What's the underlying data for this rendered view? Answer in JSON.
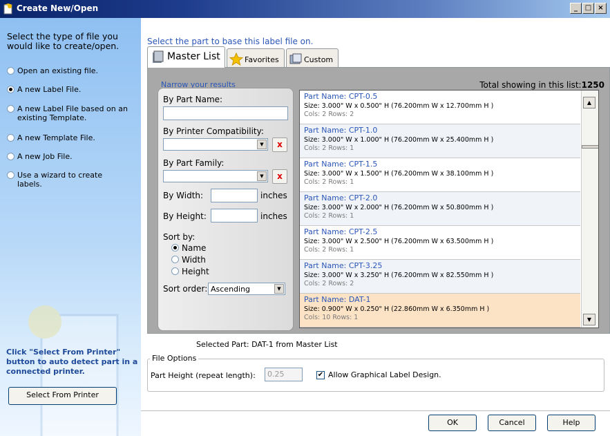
{
  "window": {
    "title": "Create New/Open",
    "controls": {
      "minimize": "_",
      "maximize": "□",
      "close": "×"
    }
  },
  "left_panel": {
    "title": "Select the type of file you would like to create/open.",
    "options": [
      {
        "label": "Open an existing file.",
        "selected": false
      },
      {
        "label": "A new Label File.",
        "selected": true
      },
      {
        "label": "A new Label File based on an existing Template.",
        "selected": false
      },
      {
        "label": "A new Template File.",
        "selected": false
      },
      {
        "label": "A new Job File.",
        "selected": false
      },
      {
        "label": "Use a wizard to create labels.",
        "selected": false
      }
    ],
    "hint": "Click \"Select From Printer\" button to auto detect part in a connected printer.",
    "select_from_printer": "Select From Printer"
  },
  "main": {
    "title": "Select the part to base this label file on.",
    "tabs": [
      {
        "label": "Master List",
        "active": true,
        "icon": "book-stack-icon"
      },
      {
        "label": "Favorites",
        "active": false,
        "icon": "star-icon"
      },
      {
        "label": "Custom",
        "active": false,
        "icon": "custom-label-icon"
      }
    ],
    "narrow_title": "Narrow your results",
    "total_label": "Total showing in this list:",
    "total_count": "1250",
    "filters": {
      "part_name_label": "By Part Name:",
      "part_name_value": "",
      "printer_label": "By Printer Compatibility:",
      "printer_value": "",
      "family_label": "By Part Family:",
      "family_value": "",
      "width_label": "By Width:",
      "width_value": "",
      "width_unit": "inches",
      "height_label": "By Height:",
      "height_value": "",
      "height_unit": "inches",
      "clear_label": "x",
      "sort_by_label": "Sort by:",
      "sort_by_options": [
        {
          "label": "Name",
          "selected": true
        },
        {
          "label": "Width",
          "selected": false
        },
        {
          "label": "Height",
          "selected": false
        }
      ],
      "sort_order_label": "Sort order:",
      "sort_order_value": "Ascending"
    },
    "parts": [
      {
        "name": "Part Name: CPT-0.5",
        "size": "Size: 3.000\" W x 0.500\" H (76.200mm W x 12.700mm H )",
        "cr": "Cols: 2 Rows: 2"
      },
      {
        "name": "Part Name: CPT-1.0",
        "size": "Size: 3.000\" W x 1.000\" H (76.200mm W x 25.400mm H )",
        "cr": "Cols: 2 Rows: 1"
      },
      {
        "name": "Part Name: CPT-1.5",
        "size": "Size: 3.000\" W x 1.500\" H (76.200mm W x 38.100mm H )",
        "cr": "Cols: 2 Rows: 1"
      },
      {
        "name": "Part Name: CPT-2.0",
        "size": "Size: 3.000\" W x 2.000\" H (76.200mm W x 50.800mm H )",
        "cr": "Cols: 2 Rows: 1"
      },
      {
        "name": "Part Name: CPT-2.5",
        "size": "Size: 3.000\" W x 2.500\" H (76.200mm W x 63.500mm H )",
        "cr": "Cols: 2 Rows: 1"
      },
      {
        "name": "Part Name: CPT-3.25",
        "size": "Size: 3.000\" W x 3.250\" H (76.200mm W x 82.550mm H )",
        "cr": "Cols: 2 Rows: 2"
      },
      {
        "name": "Part Name: DAT-1",
        "size": "Size: 0.900\" W x 0.250\" H (22.860mm W x 6.350mm H )",
        "cr": "Cols: 10 Rows: 1"
      }
    ],
    "selected_part": "Selected Part: DAT-1 from Master List",
    "file_options": {
      "title": "File Options",
      "part_height_label": "Part Height (repeat length):",
      "part_height_value": "0.25",
      "allow_graphical_label": "Allow Graphical Label Design.",
      "allow_graphical_checked": true
    }
  },
  "footer": {
    "ok": "OK",
    "cancel": "Cancel",
    "help": "Help"
  },
  "colors": {
    "accent_blue": "#2a56b8",
    "selected_row": "#fde3c6",
    "hint_blue": "#1f4a9a"
  }
}
